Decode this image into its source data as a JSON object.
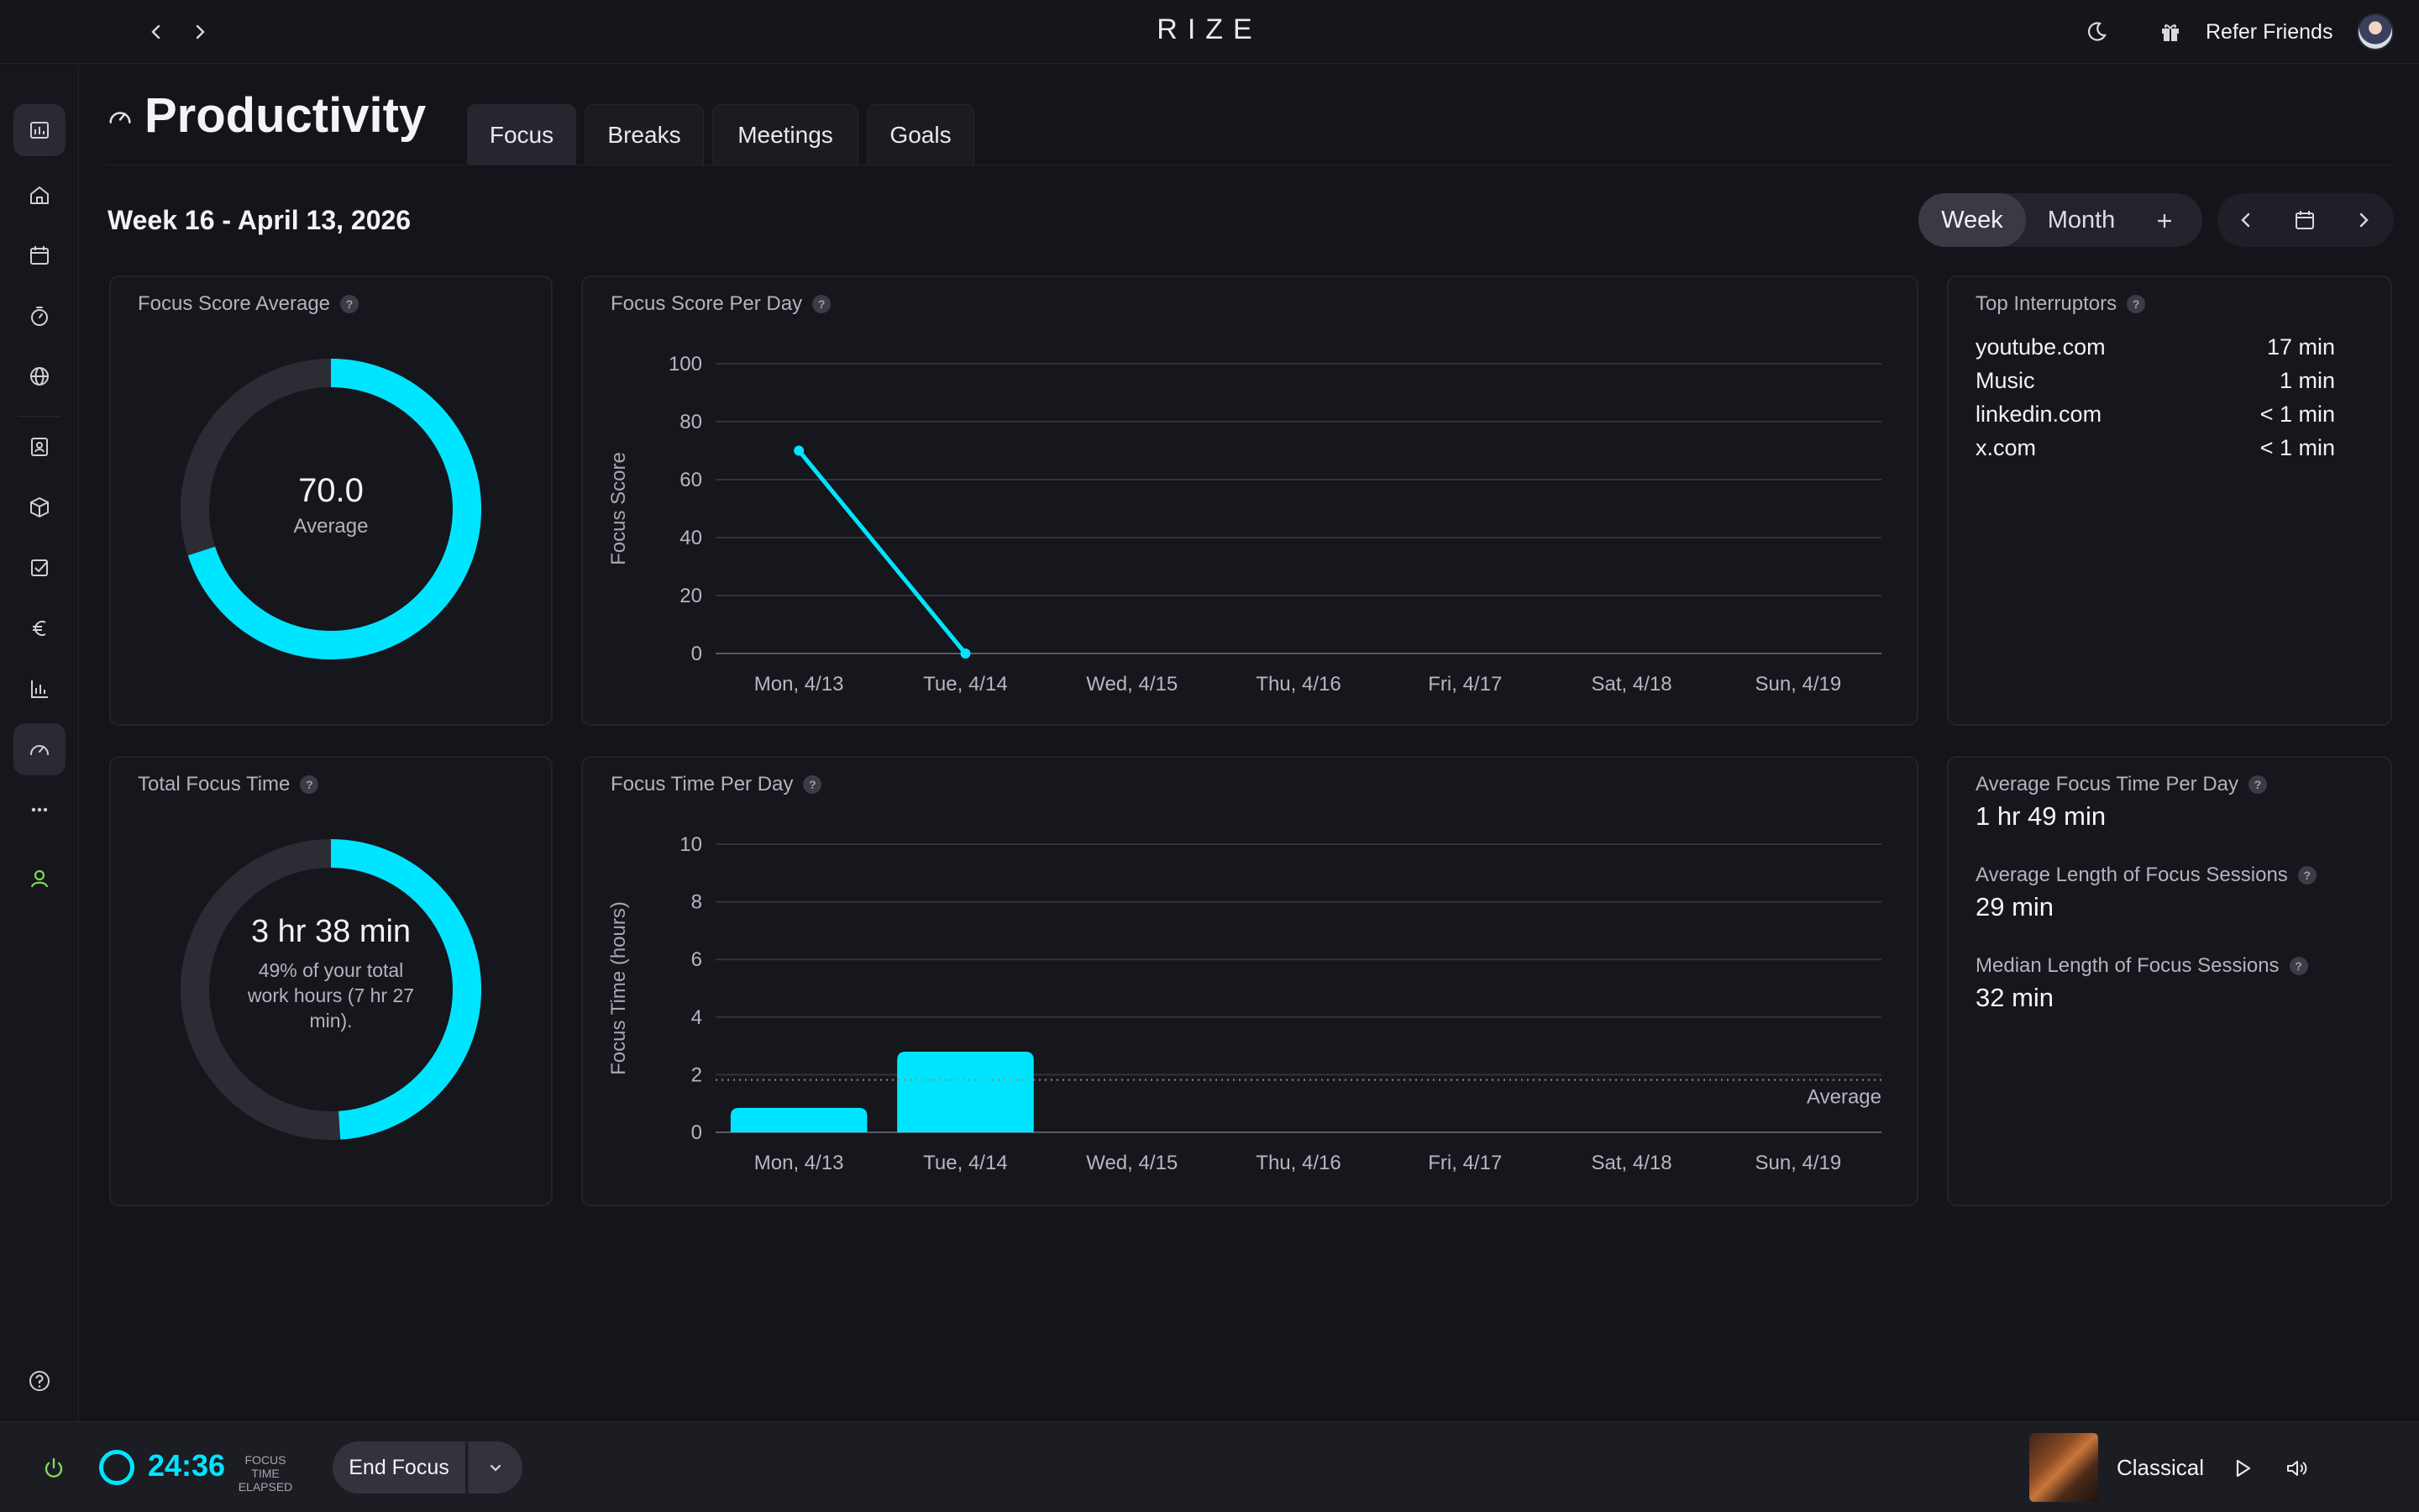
{
  "app": {
    "brand": "RIZE"
  },
  "topbar": {
    "refer_label": "Refer Friends"
  },
  "page": {
    "title": "Productivity",
    "tabs": [
      {
        "label": "Focus",
        "active": true
      },
      {
        "label": "Breaks",
        "active": false
      },
      {
        "label": "Meetings",
        "active": false
      },
      {
        "label": "Goals",
        "active": false
      }
    ],
    "week_label": "Week 16 - April 13, 2026",
    "range": {
      "week": "Week",
      "month": "Month",
      "selected": "Week"
    }
  },
  "sidebar": {
    "items": [
      "report-icon",
      "home-icon",
      "calendar-icon",
      "timer-icon",
      "globe-icon",
      "contact-icon",
      "box-icon",
      "checkbox-icon",
      "euro-icon",
      "bar-chart-icon",
      "gauge-icon",
      "more-icon",
      "user-icon"
    ],
    "active": "gauge-icon",
    "help": "help-icon"
  },
  "focus_score_avg": {
    "title": "Focus Score Average",
    "value": "70.0",
    "sub": "Average",
    "fraction": 0.7
  },
  "total_focus": {
    "title": "Total Focus Time",
    "value": "3 hr 38 min",
    "sub": "49% of your total work hours (7 hr 27 min).",
    "fraction": 0.49
  },
  "top_interruptors": {
    "title": "Top Interruptors",
    "items": [
      {
        "name": "youtube.com",
        "time": "17 min"
      },
      {
        "name": "Music",
        "time": "1 min"
      },
      {
        "name": "linkedin.com",
        "time": "< 1 min"
      },
      {
        "name": "x.com",
        "time": "< 1 min"
      }
    ]
  },
  "stats": {
    "avg_per_day_label": "Average Focus Time Per Day",
    "avg_per_day_value": "1 hr 49 min",
    "avg_len_label": "Average Length of Focus Sessions",
    "avg_len_value": "29 min",
    "median_len_label": "Median Length of Focus Sessions",
    "median_len_value": "32 min"
  },
  "chart_data": [
    {
      "id": "focus-score-per-day",
      "type": "line",
      "title": "Focus Score Per Day",
      "ylabel": "Focus Score",
      "categories": [
        "Mon, 4/13",
        "Tue, 4/14",
        "Wed, 4/15",
        "Thu, 4/16",
        "Fri, 4/17",
        "Sat, 4/18",
        "Sun, 4/19"
      ],
      "values": [
        70,
        0,
        null,
        null,
        null,
        null,
        null
      ],
      "ylim": [
        0,
        100
      ],
      "yticks": [
        0,
        20,
        40,
        60,
        80,
        100
      ],
      "grid": true,
      "color": "#00e5ff"
    },
    {
      "id": "focus-time-per-day",
      "type": "bar",
      "title": "Focus Time Per Day",
      "ylabel": "Focus Time (hours)",
      "categories": [
        "Mon, 4/13",
        "Tue, 4/14",
        "Wed, 4/15",
        "Thu, 4/16",
        "Fri, 4/17",
        "Sat, 4/18",
        "Sun, 4/19"
      ],
      "values": [
        0.85,
        2.8,
        0,
        0,
        0,
        0,
        0
      ],
      "ylim": [
        0,
        10
      ],
      "yticks": [
        0,
        2,
        4,
        6,
        8,
        10
      ],
      "average": 1.82,
      "average_label": "Average",
      "grid": true,
      "color": "#00e5ff"
    }
  ],
  "bottombar": {
    "timer": "24:36",
    "timer_sub": "FOCUS TIME ELAPSED",
    "end_focus": "End Focus",
    "music_title": "Classical"
  },
  "colors": {
    "accent": "#00e5ff",
    "track": "#2c2c35",
    "power": "#7ed957"
  }
}
